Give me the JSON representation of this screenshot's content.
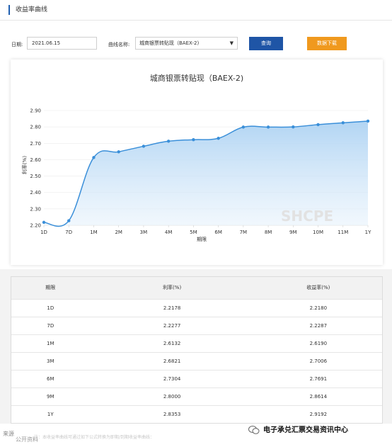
{
  "header": {
    "title": "收益率曲线"
  },
  "filters": {
    "date_label": "日期:",
    "date_value": "2021.06.15",
    "curve_label": "曲线名称:",
    "curve_value": "城商银票转贴现（BAEX-2)",
    "query_label": "查询",
    "download_label": "数据下载"
  },
  "chart": {
    "watermark": "SHCPE"
  },
  "chart_data": {
    "type": "line",
    "title": "城商银票转贴现（BAEX-2)",
    "xlabel": "期限",
    "ylabel": "利率(%)",
    "categories": [
      "1D",
      "7D",
      "1M",
      "2M",
      "3M",
      "4M",
      "5M",
      "6M",
      "7M",
      "8M",
      "9M",
      "10M",
      "11M",
      "1Y"
    ],
    "values": [
      2.2178,
      2.2277,
      2.6132,
      2.648,
      2.6821,
      2.713,
      2.722,
      2.7304,
      2.799,
      2.799,
      2.8,
      2.814,
      2.825,
      2.8353
    ],
    "ylim": [
      2.2,
      2.9
    ],
    "yticks": [
      "2.20",
      "2.30",
      "2.40",
      "2.50",
      "2.60",
      "2.70",
      "2.80",
      "2.90"
    ],
    "line_color": "#3a8fd9",
    "area_color": "#cfe4f7",
    "grid": true
  },
  "table": {
    "headers": [
      "期限",
      "利率(%)",
      "收益率(%)"
    ],
    "rows": [
      [
        "1D",
        "2.2178",
        "2.2180"
      ],
      [
        "7D",
        "2.2277",
        "2.2287"
      ],
      [
        "1M",
        "2.6132",
        "2.6190"
      ],
      [
        "3M",
        "2.6821",
        "2.7006"
      ],
      [
        "6M",
        "2.7304",
        "2.7691"
      ],
      [
        "9M",
        "2.8000",
        "2.8614"
      ],
      [
        "1Y",
        "2.8353",
        "2.9192"
      ]
    ]
  },
  "footer": {
    "source": "来源",
    "source2": "公开资料",
    "note": "注：本收益率曲线可通过如下公式转换为即期/到期收益率曲线：",
    "watermark_text": "电子承兑汇票交易资讯中心"
  },
  "colors": {
    "brand_blue": "#1f55a6",
    "orange": "#f0991e",
    "line": "#3a8fd9"
  }
}
